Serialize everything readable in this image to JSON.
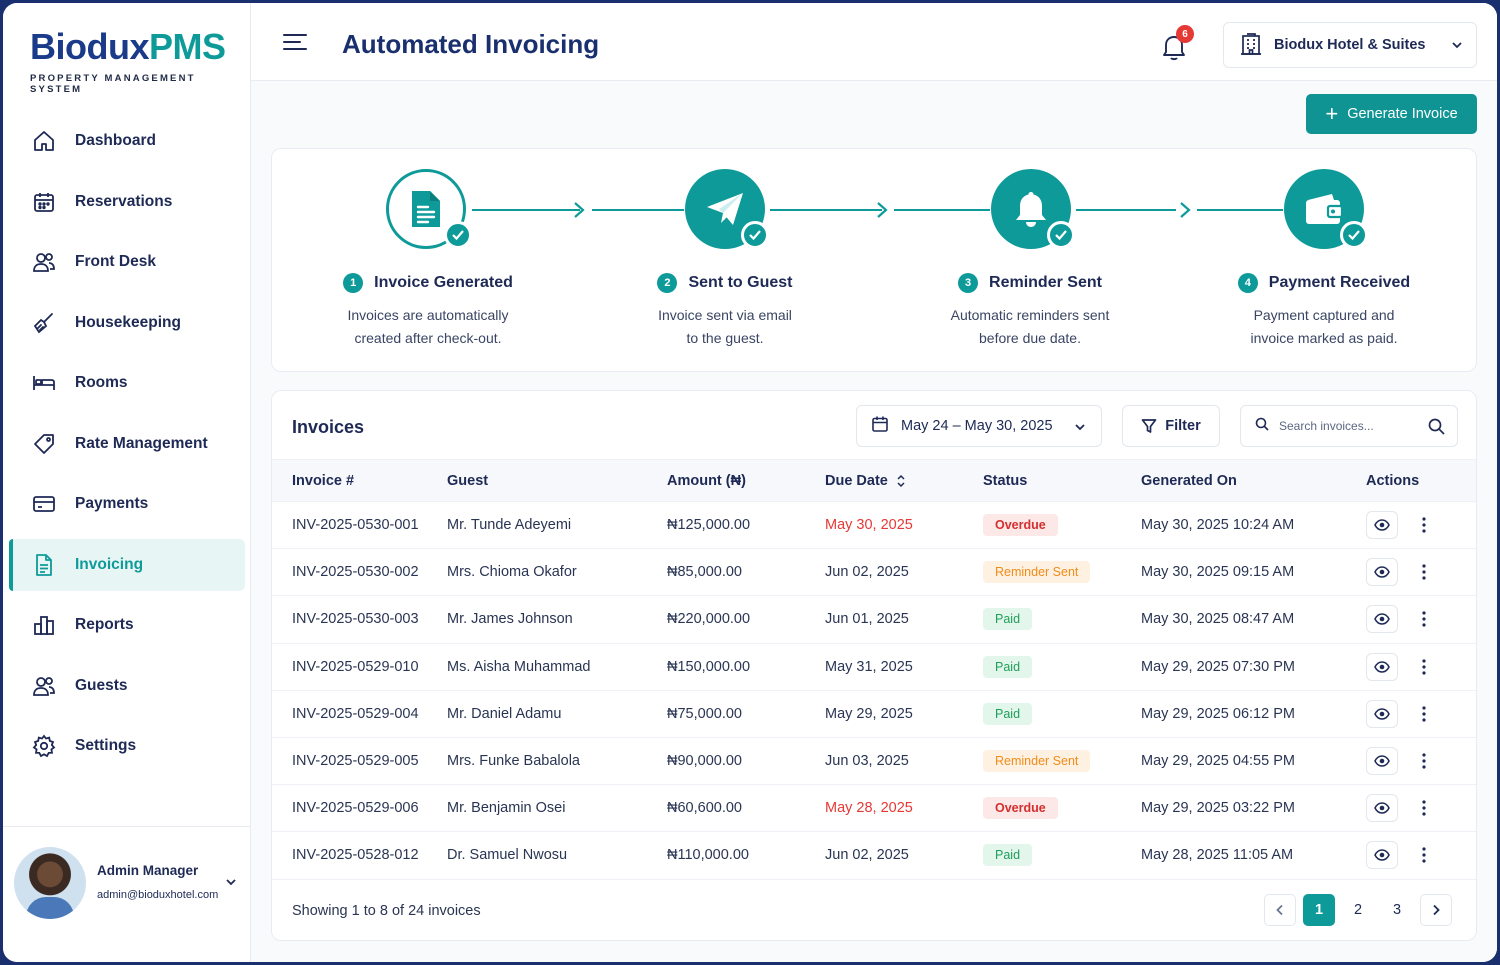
{
  "brand": {
    "name_part1": "Biodux",
    "name_part2": "PMS",
    "tagline": "PROPERTY MANAGEMENT SYSTEM"
  },
  "sidebar": {
    "items": [
      {
        "label": "Dashboard",
        "icon": "home-icon",
        "active": false
      },
      {
        "label": "Reservations",
        "icon": "calendar-icon",
        "active": false
      },
      {
        "label": "Front Desk",
        "icon": "users-icon",
        "active": false
      },
      {
        "label": "Housekeeping",
        "icon": "broom-icon",
        "active": false
      },
      {
        "label": "Rooms",
        "icon": "bed-icon",
        "active": false
      },
      {
        "label": "Rate Management",
        "icon": "tag-icon",
        "active": false
      },
      {
        "label": "Payments",
        "icon": "card-icon",
        "active": false
      },
      {
        "label": "Invoicing",
        "icon": "document-icon",
        "active": true
      },
      {
        "label": "Reports",
        "icon": "chart-icon",
        "active": false
      },
      {
        "label": "Guests",
        "icon": "guests-icon",
        "active": false
      },
      {
        "label": "Settings",
        "icon": "gear-icon",
        "active": false
      }
    ],
    "user": {
      "name": "Admin Manager",
      "email": "admin@bioduxhotel.com"
    }
  },
  "header": {
    "title": "Automated Invoicing",
    "notification_count": "6",
    "hotel": "Biodux Hotel & Suites"
  },
  "actions": {
    "generate_label": "Generate Invoice"
  },
  "workflow": {
    "steps": [
      {
        "num": "1",
        "title": "Invoice Generated",
        "desc1": "Invoices are automatically",
        "desc2": "created after check-out.",
        "icon": "document-icon"
      },
      {
        "num": "2",
        "title": "Sent to Guest",
        "desc1": "Invoice sent via email",
        "desc2": "to the guest.",
        "icon": "paper-plane-icon"
      },
      {
        "num": "3",
        "title": "Reminder Sent",
        "desc1": "Automatic reminders sent",
        "desc2": "before due date.",
        "icon": "bell-icon"
      },
      {
        "num": "4",
        "title": "Payment Received",
        "desc1": "Payment captured and",
        "desc2": "invoice marked as paid.",
        "icon": "wallet-icon"
      }
    ]
  },
  "invoices": {
    "title": "Invoices",
    "date_range": "May 24 – May 30, 2025",
    "filter_label": "Filter",
    "search_placeholder": "Search invoices...",
    "columns": [
      "Invoice #",
      "Guest",
      "Amount (₦)",
      "Due Date",
      "Status",
      "Generated On",
      "Actions"
    ],
    "rows": [
      {
        "id": "INV-2025-0530-001",
        "guest": "Mr. Tunde Adeyemi",
        "amount": "₦125,000.00",
        "due": "May 30, 2025",
        "status": "Overdue",
        "generated": "May 30, 2025 10:24 AM"
      },
      {
        "id": "INV-2025-0530-002",
        "guest": "Mrs. Chioma Okafor",
        "amount": "₦85,000.00",
        "due": "Jun 02, 2025",
        "status": "Reminder Sent",
        "generated": "May 30, 2025 09:15 AM"
      },
      {
        "id": "INV-2025-0530-003",
        "guest": "Mr. James Johnson",
        "amount": "₦220,000.00",
        "due": "Jun 01, 2025",
        "status": "Paid",
        "generated": "May 30, 2025 08:47 AM"
      },
      {
        "id": "INV-2025-0529-010",
        "guest": "Ms. Aisha Muhammad",
        "amount": "₦150,000.00",
        "due": "May 31, 2025",
        "status": "Paid",
        "generated": "May 29, 2025 07:30 PM"
      },
      {
        "id": "INV-2025-0529-004",
        "guest": "Mr. Daniel Adamu",
        "amount": "₦75,000.00",
        "due": "May 29, 2025",
        "status": "Paid",
        "generated": "May 29, 2025 06:12 PM"
      },
      {
        "id": "INV-2025-0529-005",
        "guest": "Mrs. Funke Babalola",
        "amount": "₦90,000.00",
        "due": "Jun 03, 2025",
        "status": "Reminder Sent",
        "generated": "May 29, 2025 04:55 PM"
      },
      {
        "id": "INV-2025-0529-006",
        "guest": "Mr. Benjamin Osei",
        "amount": "₦60,600.00",
        "due": "May 28, 2025",
        "status": "Overdue",
        "generated": "May 29, 2025 03:22 PM"
      },
      {
        "id": "INV-2025-0528-012",
        "guest": "Dr. Samuel Nwosu",
        "amount": "₦110,000.00",
        "due": "Jun 02, 2025",
        "status": "Paid",
        "generated": "May 28, 2025 11:05 AM"
      }
    ],
    "showing": "Showing 1 to 8 of 24 invoices",
    "pages": [
      "1",
      "2",
      "3"
    ],
    "current_page": "1"
  },
  "colors": {
    "accent": "#0f9a9a",
    "brand": "#1a3a8a",
    "overdue": "#d32f2f",
    "reminder": "#f08c1a",
    "paid": "#1f9d5a"
  }
}
